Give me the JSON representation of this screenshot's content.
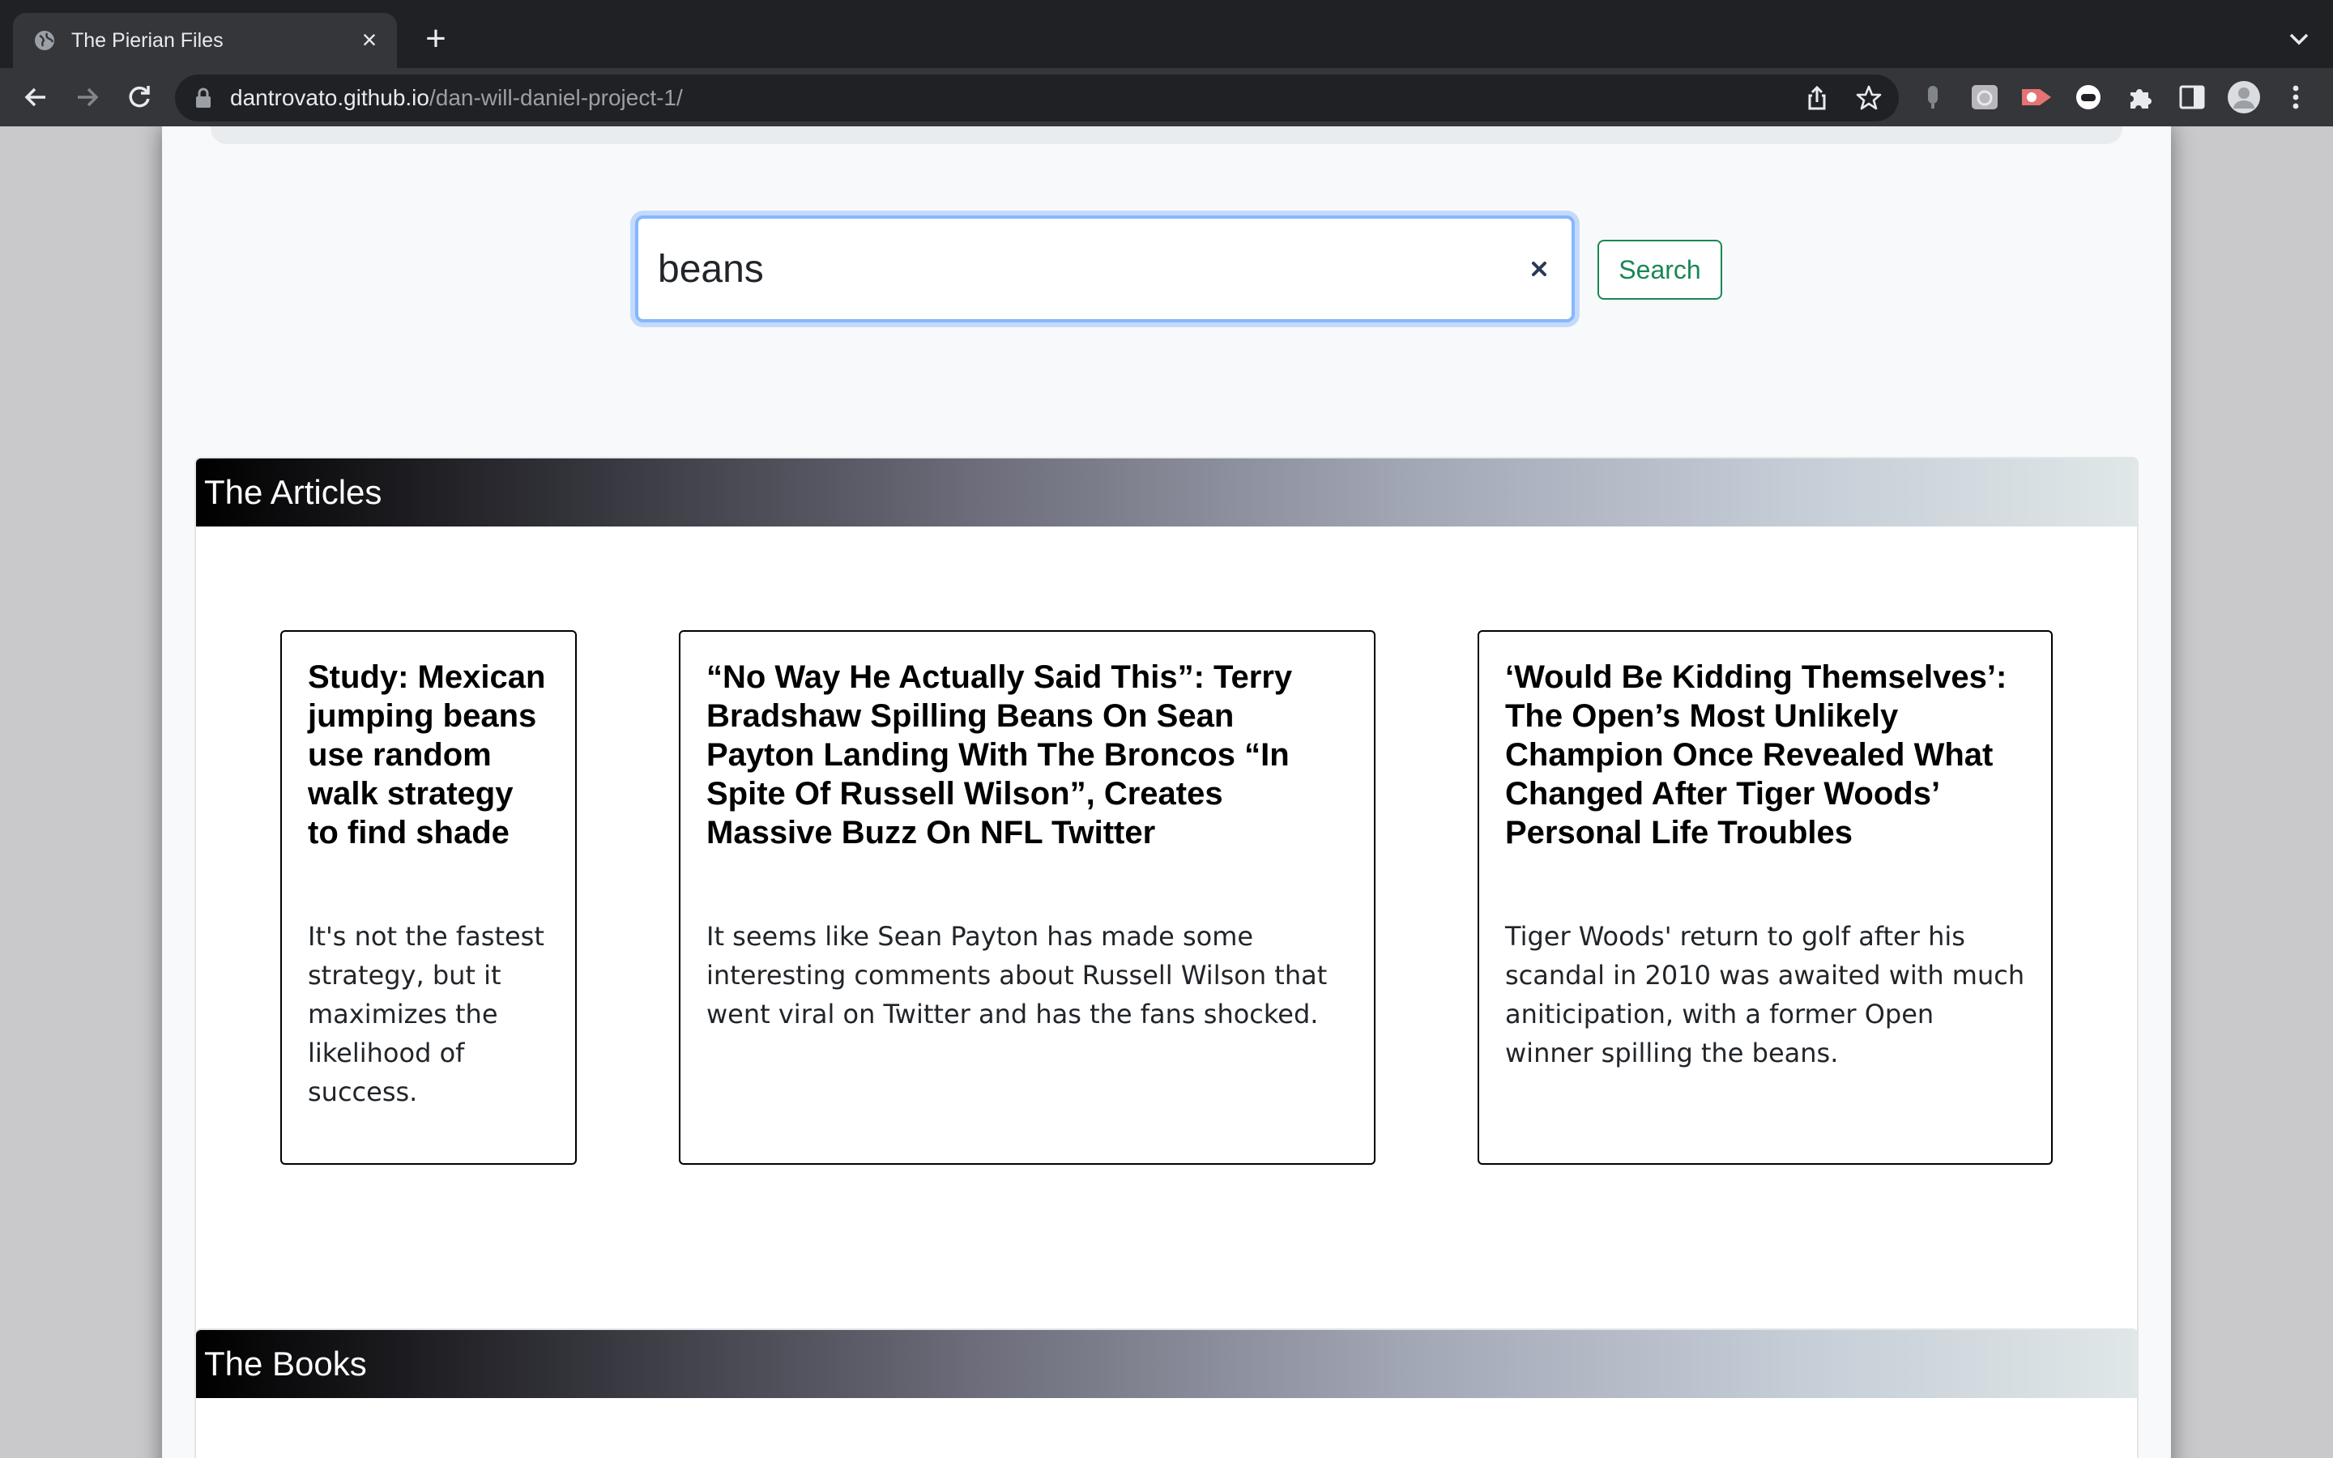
{
  "browser": {
    "tab_title": "The Pierian Files",
    "url_host": "dantrovato.github.io",
    "url_path": "/dan-will-daniel-project-1/"
  },
  "search": {
    "value": "beans",
    "button_label": "Search"
  },
  "articles": {
    "heading": "The Articles",
    "cards": [
      {
        "title": "Study: Mexican jumping beans use random walk strategy to find shade",
        "text": "It's not the fastest strategy, but it maximizes the likelihood of success."
      },
      {
        "title": "“No Way He Actually Said This”: Terry Bradshaw Spilling Beans On Sean Payton Landing With The Broncos “In Spite Of Russell Wilson”, Creates Massive Buzz On NFL Twitter",
        "text": "It seems like Sean Payton has made some interesting comments about Russell Wilson that went viral on Twitter and has the fans shocked."
      },
      {
        "title": "‘Would Be Kidding Themselves’: The Open’s Most Unlikely Champion Once Revealed What Changed After Tiger Woods’ Personal Life Troubles",
        "text": "Tiger Woods' return to golf after his scandal in 2010 was awaited with much aniticipation, with a former Open winner spilling the beans."
      }
    ]
  },
  "books": {
    "heading": "The Books"
  },
  "colors": {
    "search_button": "#198754",
    "focus_ring": "#86b7fe",
    "chrome_dark": "#202124",
    "chrome_toolbar": "#35363a"
  }
}
